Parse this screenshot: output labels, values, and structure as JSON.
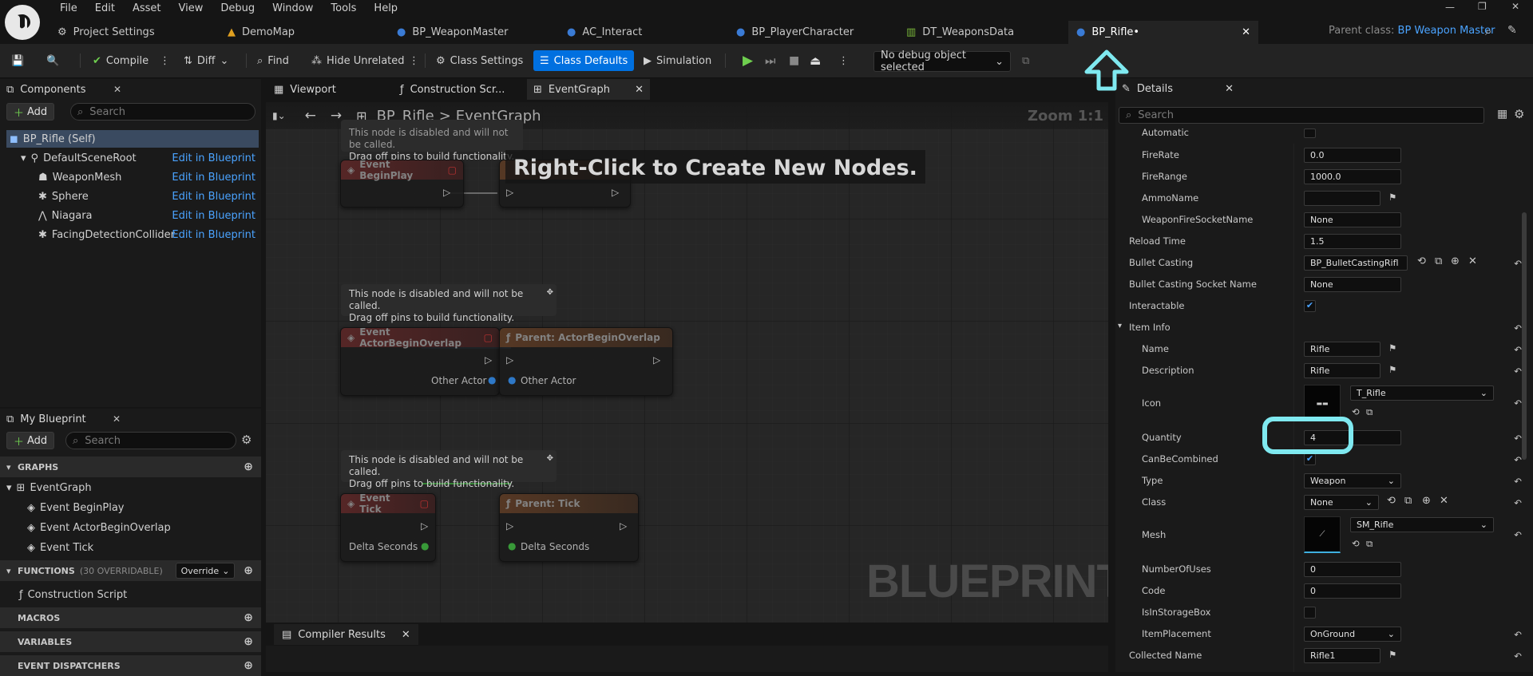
{
  "menu": [
    "File",
    "Edit",
    "Asset",
    "View",
    "Debug",
    "Window",
    "Tools",
    "Help"
  ],
  "doc_tabs": [
    {
      "label": "Project Settings",
      "icon": "gear-icon"
    },
    {
      "label": "DemoMap",
      "icon": "map-icon"
    },
    {
      "label": "BP_WeaponMaster",
      "icon": "blueprint-icon"
    },
    {
      "label": "AC_Interact",
      "icon": "blueprint-icon"
    },
    {
      "label": "BP_PlayerCharacter",
      "icon": "blueprint-icon"
    },
    {
      "label": "DT_WeaponsData",
      "icon": "datatable-icon"
    },
    {
      "label": "BP_Rifle•",
      "icon": "blueprint-icon",
      "active": true
    }
  ],
  "parent_class": {
    "label": "Parent class:",
    "value": "BP Weapon Master"
  },
  "toolbar": {
    "compile": "Compile",
    "diff": "Diff",
    "find": "Find",
    "hide_unrelated": "Hide Unrelated",
    "class_settings": "Class Settings",
    "class_defaults": "Class Defaults",
    "simulation": "Simulation",
    "debug_object": "No debug object selected"
  },
  "components": {
    "tab": "Components",
    "add": "Add",
    "search_placeholder": "Search",
    "items": [
      {
        "label": "BP_Rifle (Self)",
        "selected": true
      },
      {
        "label": "DefaultSceneRoot",
        "link": "Edit in Blueprint"
      },
      {
        "label": "WeaponMesh",
        "link": "Edit in Blueprint"
      },
      {
        "label": "Sphere",
        "link": "Edit in Blueprint"
      },
      {
        "label": "Niagara",
        "link": "Edit in Blueprint"
      },
      {
        "label": "FacingDetectionCollider",
        "link": "Edit in Blueprint"
      }
    ]
  },
  "my_blueprint": {
    "tab": "My Blueprint",
    "add": "Add",
    "search_placeholder": "Search",
    "graphs": "GRAPHS",
    "event_graph": "EventGraph",
    "events": [
      "Event BeginPlay",
      "Event ActorBeginOverlap",
      "Event Tick"
    ],
    "functions": "FUNCTIONS",
    "functions_count": "(30 OVERRIDABLE)",
    "override": "Override",
    "construction_script": "Construction Script",
    "macros": "MACROS",
    "variables": "VARIABLES",
    "dispatchers": "EVENT DISPATCHERS"
  },
  "graph_tabs": [
    "Viewport",
    "Construction Scr...",
    "EventGraph"
  ],
  "breadcrumb": {
    "root": "BP_Rifle",
    "sep": ">",
    "current": "EventGraph"
  },
  "zoom": "Zoom 1:1",
  "graph_hint": "Right-Click to Create New Nodes.",
  "watermark": "BLUEPRINT",
  "comment_text": [
    "This node is disabled and will not be called.",
    "Drag off pins to build functionality."
  ],
  "nodes": {
    "begin_play": "Event BeginPlay",
    "actor_overlap": "Event ActorBeginOverlap",
    "parent_overlap": "Parent: ActorBeginOverlap",
    "other_actor": "Other Actor",
    "tick": "Event Tick",
    "parent_tick": "Parent: Tick",
    "delta_seconds": "Delta Seconds"
  },
  "compiler_results": "Compiler Results",
  "details": {
    "tab": "Details",
    "search_placeholder": "Search",
    "automatic": "Automatic",
    "fire_rate": {
      "label": "FireRate",
      "value": "0.0"
    },
    "fire_range": {
      "label": "FireRange",
      "value": "1000.0"
    },
    "ammo_name": {
      "label": "AmmoName",
      "value": ""
    },
    "socket_name": {
      "label": "WeaponFireSocketName",
      "value": "None"
    },
    "reload_time": {
      "label": "Reload Time",
      "value": "1.5"
    },
    "bullet_casting": {
      "label": "Bullet Casting",
      "value": "BP_BulletCastingRifl"
    },
    "bullet_socket": {
      "label": "Bullet Casting Socket Name",
      "value": "None"
    },
    "interactable": {
      "label": "Interactable"
    },
    "item_info": "Item Info",
    "name": {
      "label": "Name",
      "value": "Rifle"
    },
    "description": {
      "label": "Description",
      "value": "Rifle"
    },
    "icon": {
      "label": "Icon",
      "value": "T_Rifle"
    },
    "quantity": {
      "label": "Quantity",
      "value": "4"
    },
    "can_be_combined": {
      "label": "CanBeCombined"
    },
    "type": {
      "label": "Type",
      "value": "Weapon"
    },
    "class": {
      "label": "Class",
      "value": "None"
    },
    "mesh": {
      "label": "Mesh",
      "value": "SM_Rifle"
    },
    "number_of_uses": {
      "label": "NumberOfUses",
      "value": "0"
    },
    "code": {
      "label": "Code",
      "value": "0"
    },
    "in_storage": {
      "label": "IsInStorageBox"
    },
    "item_placement": {
      "label": "ItemPlacement",
      "value": "OnGround"
    },
    "collected_name": {
      "label": "Collected Name",
      "value": "Rifle1"
    }
  },
  "colors": {
    "accent": "#0070e0",
    "link": "#4aa3ff",
    "highlight": "#7fe9f0"
  }
}
